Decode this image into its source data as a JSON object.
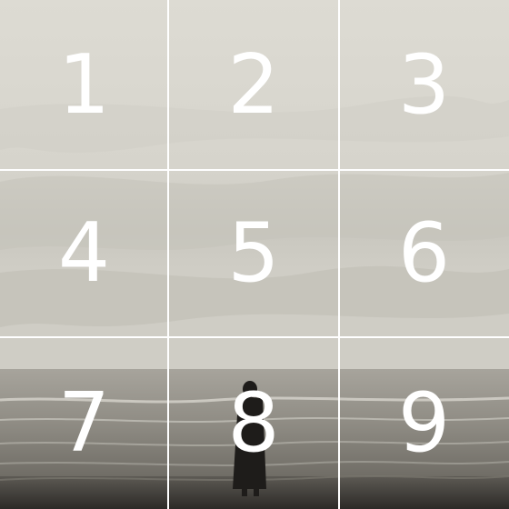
{
  "tiles": [
    {
      "number": "1"
    },
    {
      "number": "2"
    },
    {
      "number": "3"
    },
    {
      "number": "4"
    },
    {
      "number": "5"
    },
    {
      "number": "6"
    },
    {
      "number": "7"
    },
    {
      "number": "8"
    },
    {
      "number": "9"
    }
  ],
  "colors": {
    "grid_line": "#ffffff",
    "number_text": "#ffffff",
    "sky": "#d9d7cf",
    "cloud_dark": "#b9b7ae",
    "sea": "#8a8780",
    "beach": "#3a3733"
  }
}
